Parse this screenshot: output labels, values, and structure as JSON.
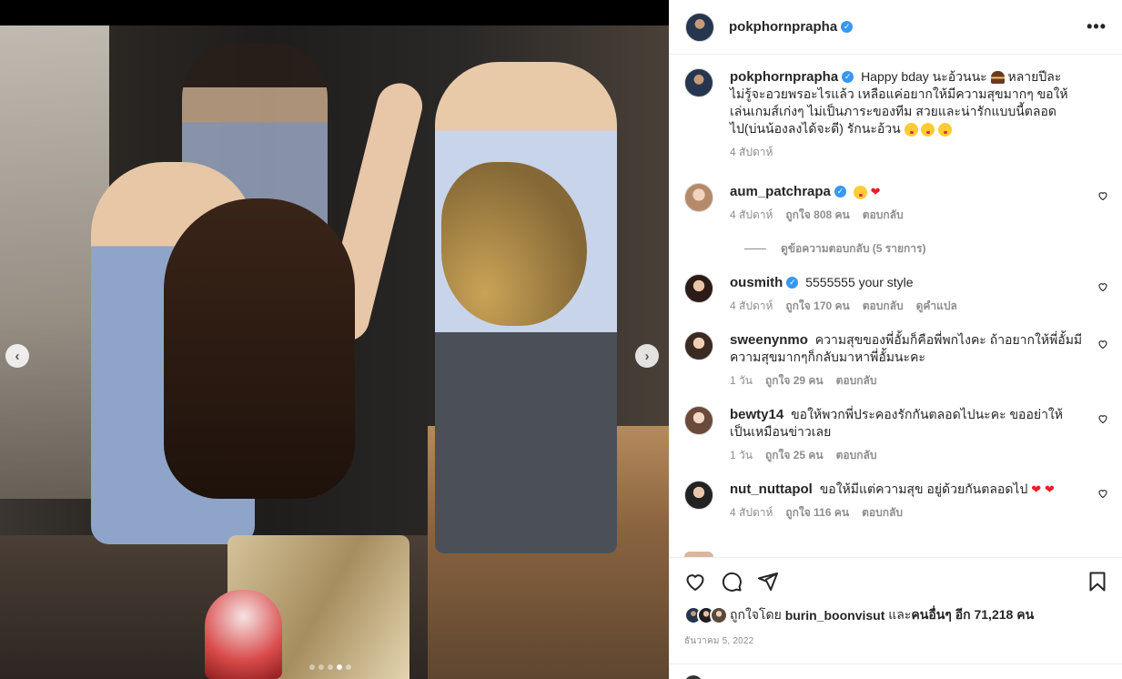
{
  "post": {
    "author": "pokphornprapha",
    "verified_mark": "✓",
    "more_label": "•••",
    "caption_text": "Happy bday นะอ้วนนะ",
    "caption_text_2": "หลายปีละไม่รู้จะอวยพรอะไรแล้ว เหลือแค่อยากให้มีความสุขมากๆ ขอให้เล่นเกมส์เก่งๆ ไม่เป็นภาระของทีม สวยและน่ารักแบบนี้ตลอดไป(บ่นน้องลงได้จะดี) รักนะอ้วน",
    "caption_time": "4 สัปดาห์",
    "likes_prefix": "ถูกใจโดย",
    "likes_user": "burin_boonvisut",
    "likes_and": "และ",
    "likes_others": "คนอื่นๆ อีก 71,218 คน",
    "date": "ธันวาคม 5, 2022"
  },
  "media": {
    "prev_label": "‹",
    "next_label": "›",
    "dots_total": 5,
    "dots_active": 3
  },
  "comments": [
    {
      "user": "aum_patchrapa",
      "verified": true,
      "text": "",
      "time": "4 สัปดาห์",
      "likes": "ถูกใจ 808 คน",
      "reply": "ตอบกลับ",
      "translate": ""
    },
    {
      "user": "ousmith",
      "verified": true,
      "text": "5555555 your style",
      "time": "4 สัปดาห์",
      "likes": "ถูกใจ 170 คน",
      "reply": "ตอบกลับ",
      "translate": "ดูคำแปล"
    },
    {
      "user": "sweenynmo",
      "verified": false,
      "text": "ความสุขของพี่อั้มก็คือพี่พกไงคะ ถ้าอยากให้พี่อั้มมีความสุขมากๆก็กลับมาหาพี่อั้มนะคะ",
      "time": "1 วัน",
      "likes": "ถูกใจ 29 คน",
      "reply": "ตอบกลับ",
      "translate": ""
    },
    {
      "user": "bewty14",
      "verified": false,
      "text": "ขอให้พวกพี่ประคองรักกันตลอดไปนะคะ ขออย่าให้เป็นเหมือนข่าวเลย",
      "time": "1 วัน",
      "likes": "ถูกใจ 25 คน",
      "reply": "ตอบกลับ",
      "translate": ""
    },
    {
      "user": "nut_nuttapol",
      "verified": false,
      "text": "ขอให้มีแต่ความสุข อยู่ด้วยกันตลอดไป",
      "time": "4 สัปดาห์",
      "likes": "ถูกใจ 116 คน",
      "reply": "ตอบกลับ",
      "translate": ""
    }
  ],
  "replies_toggle": "ดูข้อความตอบกลับ (5 รายการ)",
  "icons": {
    "like": "heart-icon",
    "comment": "comment-icon",
    "share": "share-icon",
    "save": "bookmark-icon"
  },
  "colors": {
    "verified": "#3897f0",
    "muted": "#8e8e8e",
    "text": "#262626",
    "heart": "#ed1c24"
  }
}
